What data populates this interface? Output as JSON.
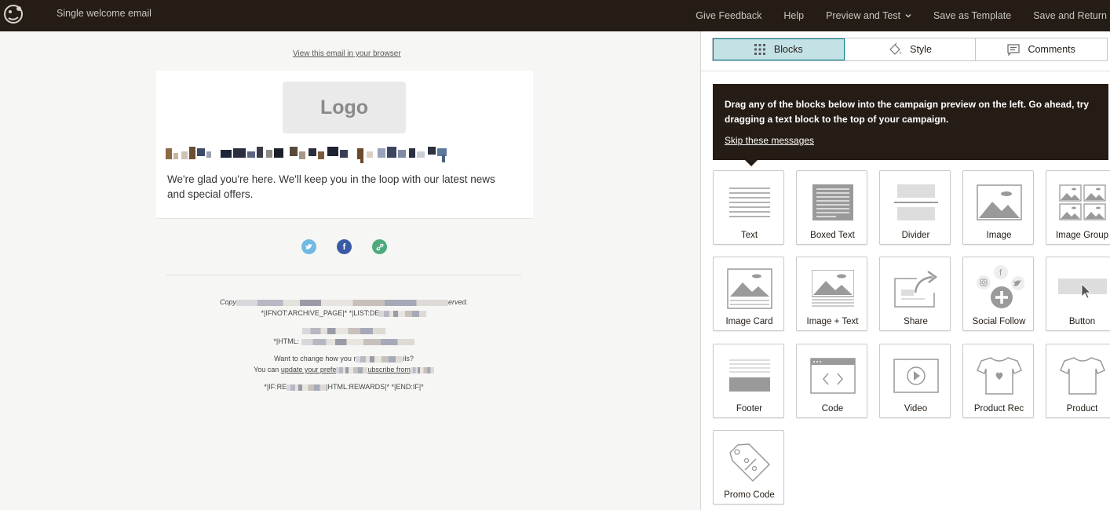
{
  "header": {
    "campaign_title": "Single welcome email",
    "nav": {
      "feedback": "Give Feedback",
      "help": "Help",
      "preview_test": "Preview and Test",
      "save_template": "Save as Template",
      "save_return": "Save and Return"
    }
  },
  "preview": {
    "view_in_browser": "View this email in your browser",
    "logo_placeholder": "Logo",
    "body_text": "We're glad you're here. We'll keep you in the loop with our latest news and special offers.",
    "footer": {
      "copy_prefix": "Copy",
      "copy_suffix": "erved.",
      "ifnot_line": "*|IFNOT:ARCHIVE_PAGE|* *|LIST:DE",
      "html_prefix": "*|HTML:",
      "want_change": "Want to change how you r",
      "want_change_suffix": "ils?",
      "you_can": "You can",
      "update_prefs": "update your prefe",
      "unsub": "ubscribe from",
      "rewards_prefix": "*|IF:RE",
      "rewards_suffix": "|HTML:REWARDS|* *|END:IF|*"
    }
  },
  "panel": {
    "tabs": [
      {
        "label": "Blocks",
        "icon": "grid-icon",
        "active": true
      },
      {
        "label": "Style",
        "icon": "paint-bucket-icon",
        "active": false
      },
      {
        "label": "Comments",
        "icon": "comment-icon",
        "active": false
      }
    ],
    "tip": {
      "text": "Drag any of the blocks below into the campaign preview on the left. Go ahead, try dragging a text block to the top of your campaign.",
      "skip": "Skip these messages"
    },
    "blocks": [
      {
        "label": "Text",
        "icon": "text-lines-icon"
      },
      {
        "label": "Boxed Text",
        "icon": "boxed-text-icon"
      },
      {
        "label": "Divider",
        "icon": "divider-icon"
      },
      {
        "label": "Image",
        "icon": "image-icon"
      },
      {
        "label": "Image Group",
        "icon": "image-group-icon"
      },
      {
        "label": "Image Card",
        "icon": "image-card-icon"
      },
      {
        "label": "Image + Text",
        "icon": "image-text-icon"
      },
      {
        "label": "Share",
        "icon": "share-icon"
      },
      {
        "label": "Social Follow",
        "icon": "social-follow-icon"
      },
      {
        "label": "Button",
        "icon": "button-icon"
      },
      {
        "label": "Footer",
        "icon": "footer-icon"
      },
      {
        "label": "Code",
        "icon": "code-icon"
      },
      {
        "label": "Video",
        "icon": "video-icon"
      },
      {
        "label": "Product Rec",
        "icon": "product-rec-icon"
      },
      {
        "label": "Product",
        "icon": "product-icon"
      },
      {
        "label": "Promo Code",
        "icon": "promo-code-icon"
      }
    ]
  },
  "colors": {
    "topbar": "#241c15",
    "active_tab": "#c4e2e6",
    "accent": "#007c89",
    "twitter": "#6fb9e2",
    "facebook": "#3b5aa5",
    "link": "#4eaa7c"
  }
}
